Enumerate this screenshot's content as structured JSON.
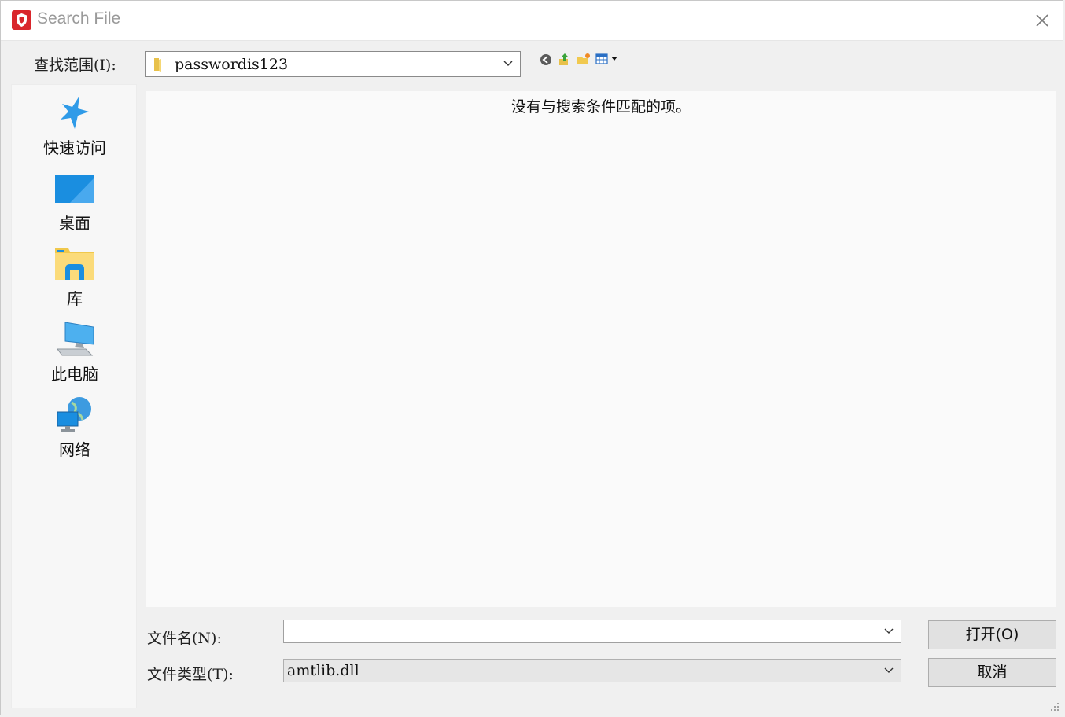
{
  "window": {
    "title": "Search File"
  },
  "lookin": {
    "label": "查找范围(I):",
    "value": "passwordis123"
  },
  "toolbar": {
    "icons": [
      "back-icon",
      "up-folder-icon",
      "new-folder-icon",
      "view-menu-icon"
    ]
  },
  "places": [
    {
      "label": "快速访问",
      "icon": "star-icon"
    },
    {
      "label": "桌面",
      "icon": "desktop-icon"
    },
    {
      "label": "库",
      "icon": "library-icon"
    },
    {
      "label": "此电脑",
      "icon": "computer-icon"
    },
    {
      "label": "网络",
      "icon": "network-icon"
    }
  ],
  "filelist": {
    "empty_message": "没有与搜索条件匹配的项。"
  },
  "filename": {
    "label": "文件名(N):",
    "value": ""
  },
  "filetype": {
    "label": "文件类型(T):",
    "value": "amtlib.dll"
  },
  "buttons": {
    "open": "打开(O)",
    "cancel": "取消"
  },
  "colors": {
    "brand": "#d9262c",
    "accent": "#1e90e8"
  }
}
